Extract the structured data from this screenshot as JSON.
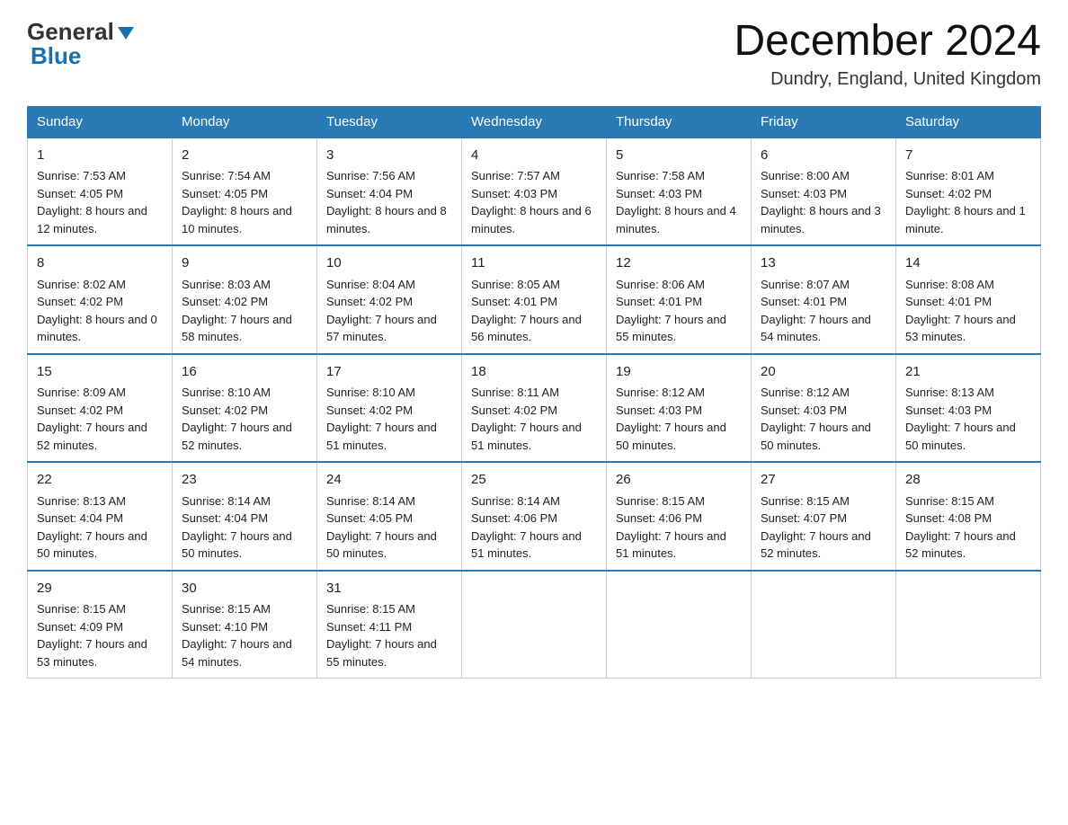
{
  "header": {
    "logo_general": "General",
    "logo_blue": "Blue",
    "month_title": "December 2024",
    "location": "Dundry, England, United Kingdom"
  },
  "days_of_week": [
    "Sunday",
    "Monday",
    "Tuesday",
    "Wednesday",
    "Thursday",
    "Friday",
    "Saturday"
  ],
  "weeks": [
    [
      {
        "day": "1",
        "sunrise": "7:53 AM",
        "sunset": "4:05 PM",
        "daylight": "8 hours and 12 minutes."
      },
      {
        "day": "2",
        "sunrise": "7:54 AM",
        "sunset": "4:05 PM",
        "daylight": "8 hours and 10 minutes."
      },
      {
        "day": "3",
        "sunrise": "7:56 AM",
        "sunset": "4:04 PM",
        "daylight": "8 hours and 8 minutes."
      },
      {
        "day": "4",
        "sunrise": "7:57 AM",
        "sunset": "4:03 PM",
        "daylight": "8 hours and 6 minutes."
      },
      {
        "day": "5",
        "sunrise": "7:58 AM",
        "sunset": "4:03 PM",
        "daylight": "8 hours and 4 minutes."
      },
      {
        "day": "6",
        "sunrise": "8:00 AM",
        "sunset": "4:03 PM",
        "daylight": "8 hours and 3 minutes."
      },
      {
        "day": "7",
        "sunrise": "8:01 AM",
        "sunset": "4:02 PM",
        "daylight": "8 hours and 1 minute."
      }
    ],
    [
      {
        "day": "8",
        "sunrise": "8:02 AM",
        "sunset": "4:02 PM",
        "daylight": "8 hours and 0 minutes."
      },
      {
        "day": "9",
        "sunrise": "8:03 AM",
        "sunset": "4:02 PM",
        "daylight": "7 hours and 58 minutes."
      },
      {
        "day": "10",
        "sunrise": "8:04 AM",
        "sunset": "4:02 PM",
        "daylight": "7 hours and 57 minutes."
      },
      {
        "day": "11",
        "sunrise": "8:05 AM",
        "sunset": "4:01 PM",
        "daylight": "7 hours and 56 minutes."
      },
      {
        "day": "12",
        "sunrise": "8:06 AM",
        "sunset": "4:01 PM",
        "daylight": "7 hours and 55 minutes."
      },
      {
        "day": "13",
        "sunrise": "8:07 AM",
        "sunset": "4:01 PM",
        "daylight": "7 hours and 54 minutes."
      },
      {
        "day": "14",
        "sunrise": "8:08 AM",
        "sunset": "4:01 PM",
        "daylight": "7 hours and 53 minutes."
      }
    ],
    [
      {
        "day": "15",
        "sunrise": "8:09 AM",
        "sunset": "4:02 PM",
        "daylight": "7 hours and 52 minutes."
      },
      {
        "day": "16",
        "sunrise": "8:10 AM",
        "sunset": "4:02 PM",
        "daylight": "7 hours and 52 minutes."
      },
      {
        "day": "17",
        "sunrise": "8:10 AM",
        "sunset": "4:02 PM",
        "daylight": "7 hours and 51 minutes."
      },
      {
        "day": "18",
        "sunrise": "8:11 AM",
        "sunset": "4:02 PM",
        "daylight": "7 hours and 51 minutes."
      },
      {
        "day": "19",
        "sunrise": "8:12 AM",
        "sunset": "4:03 PM",
        "daylight": "7 hours and 50 minutes."
      },
      {
        "day": "20",
        "sunrise": "8:12 AM",
        "sunset": "4:03 PM",
        "daylight": "7 hours and 50 minutes."
      },
      {
        "day": "21",
        "sunrise": "8:13 AM",
        "sunset": "4:03 PM",
        "daylight": "7 hours and 50 minutes."
      }
    ],
    [
      {
        "day": "22",
        "sunrise": "8:13 AM",
        "sunset": "4:04 PM",
        "daylight": "7 hours and 50 minutes."
      },
      {
        "day": "23",
        "sunrise": "8:14 AM",
        "sunset": "4:04 PM",
        "daylight": "7 hours and 50 minutes."
      },
      {
        "day": "24",
        "sunrise": "8:14 AM",
        "sunset": "4:05 PM",
        "daylight": "7 hours and 50 minutes."
      },
      {
        "day": "25",
        "sunrise": "8:14 AM",
        "sunset": "4:06 PM",
        "daylight": "7 hours and 51 minutes."
      },
      {
        "day": "26",
        "sunrise": "8:15 AM",
        "sunset": "4:06 PM",
        "daylight": "7 hours and 51 minutes."
      },
      {
        "day": "27",
        "sunrise": "8:15 AM",
        "sunset": "4:07 PM",
        "daylight": "7 hours and 52 minutes."
      },
      {
        "day": "28",
        "sunrise": "8:15 AM",
        "sunset": "4:08 PM",
        "daylight": "7 hours and 52 minutes."
      }
    ],
    [
      {
        "day": "29",
        "sunrise": "8:15 AM",
        "sunset": "4:09 PM",
        "daylight": "7 hours and 53 minutes."
      },
      {
        "day": "30",
        "sunrise": "8:15 AM",
        "sunset": "4:10 PM",
        "daylight": "7 hours and 54 minutes."
      },
      {
        "day": "31",
        "sunrise": "8:15 AM",
        "sunset": "4:11 PM",
        "daylight": "7 hours and 55 minutes."
      },
      null,
      null,
      null,
      null
    ]
  ],
  "labels": {
    "sunrise_prefix": "Sunrise: ",
    "sunset_prefix": "Sunset: ",
    "daylight_prefix": "Daylight: "
  }
}
